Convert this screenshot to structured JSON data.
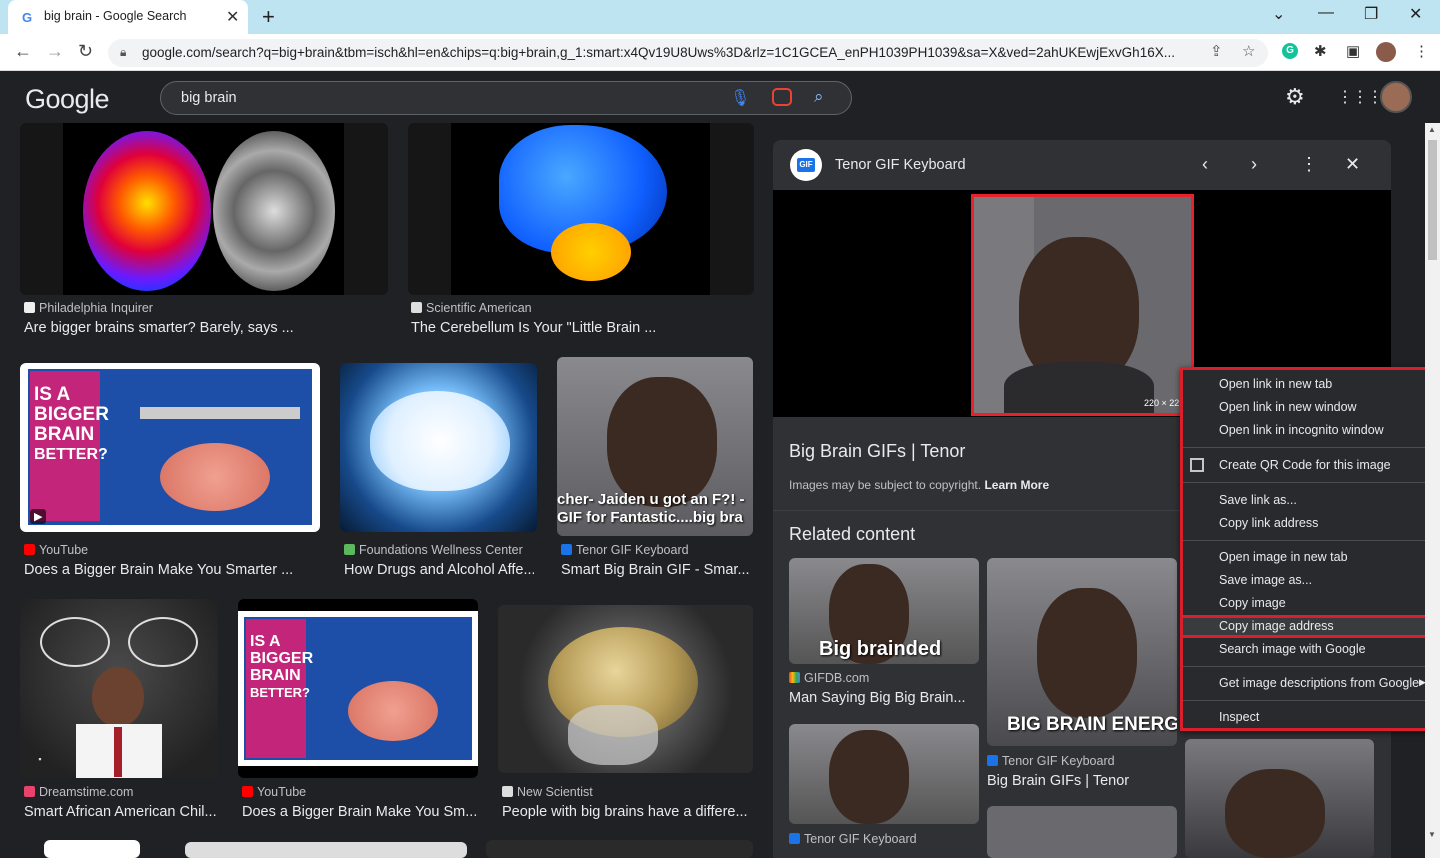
{
  "browser": {
    "tab_title": "big brain - Google Search",
    "url": "google.com/search?q=big+brain&tbm=isch&hl=en&chips=q:big+brain,g_1:smart:x4Qv19U8Uws%3D&rlz=1C1GCEA_enPH1039PH1039&sa=X&ved=2ahUKEwjExvGh16X..."
  },
  "google": {
    "logo": "Google",
    "query": "big brain"
  },
  "results": [
    {
      "source": "Philadelphia Inquirer",
      "title": "Are bigger brains smarter? Barely, says ..."
    },
    {
      "source": "Scientific American",
      "title": "The Cerebellum Is Your \"Little Brain ..."
    },
    {
      "source": "YouTube",
      "title": "Does a Bigger Brain Make You Smarter ..."
    },
    {
      "source": "Foundations Wellness Center",
      "title": "How Drugs and Alcohol Affe..."
    },
    {
      "source": "Tenor GIF Keyboard",
      "title": "Smart Big Brain GIF - Smar..."
    },
    {
      "source": "Dreamstime.com",
      "title": "Smart African American Chil..."
    },
    {
      "source": "YouTube",
      "title": "Does a Bigger Brain Make You Sm..."
    },
    {
      "source": "New Scientist",
      "title": "People with big brains have a differe..."
    }
  ],
  "thumb_text": {
    "bigger_brain": [
      "IS A",
      "BIGGER",
      "BRAIN",
      "BETTER?"
    ],
    "tenor_caption": "cher- Jaiden u got an F?! - GIF for Fantastic....big bra"
  },
  "panel": {
    "source": "Tenor GIF Keyboard",
    "dimensions": "220 × 22",
    "title": "Big Brain GIFs | Tenor",
    "copyright": "Images may be subject to copyright.",
    "learn_more": "Learn More",
    "related_heading": "Related content",
    "related": [
      {
        "caption": "Big brainded",
        "source": "GIFDB.com",
        "title": "Man Saying Big Big Brain..."
      },
      {
        "caption": "BIG BRAIN ENERGI",
        "source": "Tenor GIF Keyboard",
        "title": "Big Brain GIFs | Tenor"
      },
      {
        "source": "Tenor GIF Keyboard"
      }
    ]
  },
  "context_menu": {
    "items": [
      "Open link in new tab",
      "Open link in new window",
      "Open link in incognito window",
      "Create QR Code for this image",
      "Save link as...",
      "Copy link address",
      "Open image in new tab",
      "Save image as...",
      "Copy image",
      "Copy image address",
      "Search image with Google",
      "Get image descriptions from Google",
      "Inspect"
    ],
    "highlighted": "Copy image address"
  },
  "colors": {
    "background": "#202124",
    "panel": "#303134",
    "highlight_border": "#d91f2c",
    "link_blue": "#8ab4f8"
  }
}
